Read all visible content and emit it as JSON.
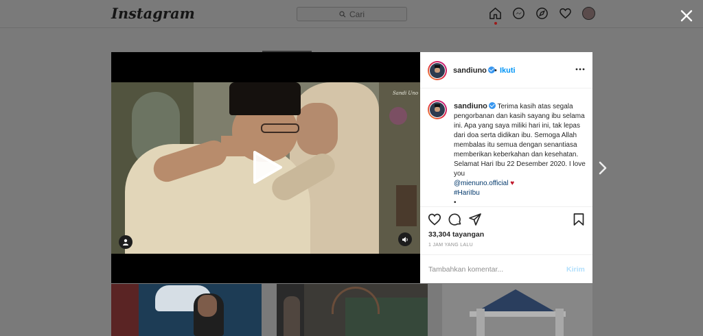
{
  "topbar": {
    "logo": "Instagram",
    "search_placeholder": "Cari",
    "icons": [
      "home-icon",
      "messenger-icon",
      "explore-icon",
      "heart-icon",
      "avatar"
    ]
  },
  "post": {
    "username": "sandiuno",
    "follow_label": "Ikuti",
    "caption": {
      "username": "sandiuno",
      "text": "Terima kasih atas segala pengorbanan dan kasih sayang ibu selama ini. Apa yang saya miliki hari ini, tak lepas dari doa serta didikan ibu. Semoga Allah membalas itu semua dengan senantiasa memberikan keberkahan dan kesehatan. Selamat Hari Ibu 22 Desember 2020. I love you",
      "mention": "@mienuno.official",
      "heart": "♥",
      "hashtag": "#HariIbu",
      "trail": "•"
    },
    "views": "33,304 tayangan",
    "time": "1 JAM YANG LALU",
    "comment_placeholder": "Tambahkan komentar...",
    "post_label": "Kirim",
    "video_watermark": "Sandi Uno"
  },
  "colors": {
    "accent": "#0095f6",
    "verified": "#3897f0",
    "overlay": "#7a7a7a",
    "post_disabled": "#b2dffc"
  }
}
